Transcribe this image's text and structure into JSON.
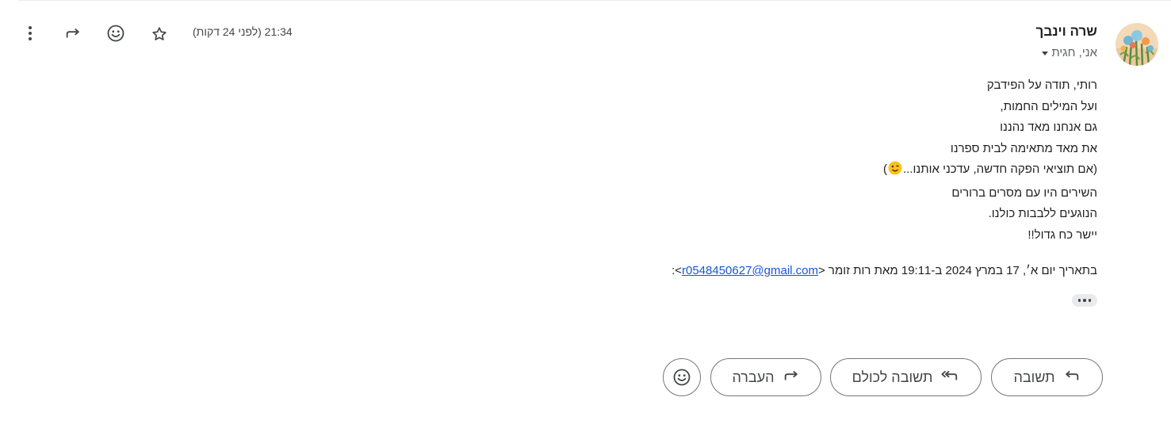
{
  "message": {
    "sender_name": "שרה וינבך",
    "recipients": "אני, חגית",
    "timestamp": "21:34 (לפני 24 דקות)",
    "body_lines": [
      "רותי, תודה על הפידבק",
      "ועל המילים החמות,",
      "גם אנחנו מאד נהננו",
      "את מאד מתאימה לבית ספרנו"
    ],
    "emoji_line_before": "(אם תוציאי הפקה חדשה, עדכני אותנו...",
    "emoji_line_after": ")",
    "body_lines_2": [
      "השירים היו עם מסרים ברורים",
      "הנוגעים ללבבות כולנו.",
      "יישר כח גדול!!"
    ],
    "quote_prefix": "בתאריך יום א׳, 17 במרץ 2024 ב-19:11 מאת רות זומר <",
    "quote_email": "r0548450627@gmail.com",
    "quote_suffix": ">:"
  },
  "icons": {
    "more": "more-vert-icon",
    "forward": "forward-icon",
    "emoji": "add-reaction-icon",
    "star": "star-icon",
    "show_trimmed": "ellipsis-icon"
  },
  "actions": {
    "reply_label": "תשובה",
    "reply_all_label": "תשובה לכולם",
    "forward_label": "העברה"
  },
  "colors": {
    "link": "#1558d6",
    "button_border": "#747775",
    "text": "#202124"
  }
}
